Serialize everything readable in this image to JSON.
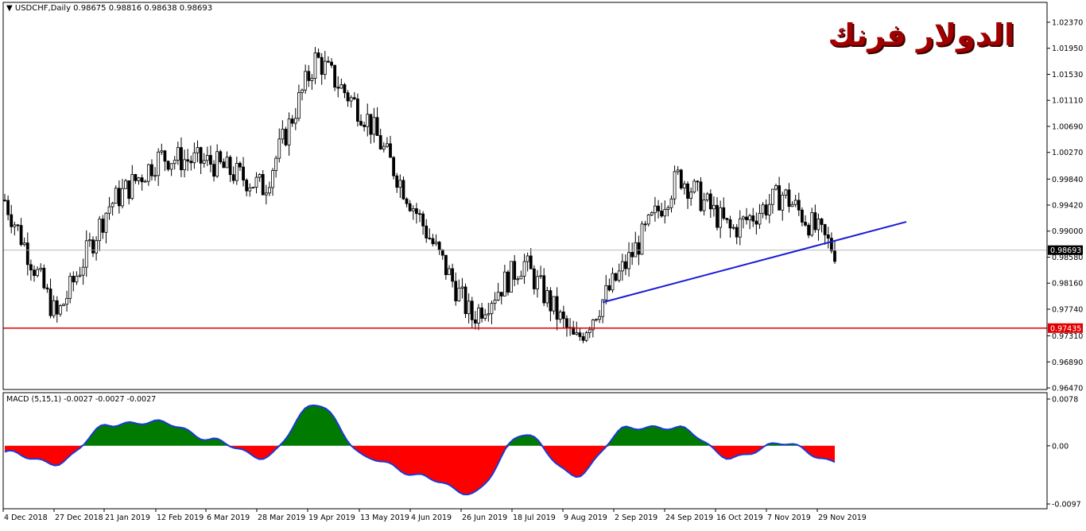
{
  "header": {
    "symbol_line": "USDCHF,Daily  0.98675 0.98816 0.98638 0.98693",
    "overlay_title": "الدولار فرنك"
  },
  "macd": {
    "label": "MACD (5,15,1) -0.0027 -0.0027 -0.0027",
    "axis_ticks": [
      "0.0078",
      "0.00",
      "-0.0097"
    ]
  },
  "price_axis_ticks": [
    "1.02370",
    "1.01950",
    "1.01530",
    "1.01110",
    "1.00690",
    "1.00270",
    "0.99840",
    "0.99420",
    "0.99000",
    "0.98580",
    "0.98160",
    "0.97740",
    "0.97310",
    "0.96890",
    "0.96470"
  ],
  "current_price_label": "0.98693",
  "support_label": "0.97435",
  "date_ticks": [
    "4 Dec 2018",
    "27 Dec 2018",
    "21 Jan 2019",
    "12 Feb 2019",
    "6 Mar 2019",
    "28 Mar 2019",
    "19 Apr 2019",
    "13 May 2019",
    "4 Jun 2019",
    "26 Jun 2019",
    "18 Jul 2019",
    "9 Aug 2019",
    "2 Sep 2019",
    "24 Sep 2019",
    "16 Oct 2019",
    "7 Nov 2019",
    "29 Nov 2019"
  ],
  "colors": {
    "candle": "#000000",
    "support_line": "#e00000",
    "trend_line": "#1a1ad6",
    "macd_positive": "#007a00",
    "macd_negative": "#ff0000",
    "macd_outline": "#1a3ad6",
    "current_price_line": "#b0b0b0"
  },
  "chart_data": [
    {
      "type": "candlestick",
      "title": "USDCHF,Daily",
      "ohlc_last": {
        "open": 0.98675,
        "high": 0.98816,
        "low": 0.98638,
        "close": 0.98693
      },
      "x": [
        "4 Dec 2018",
        "27 Dec 2018",
        "21 Jan 2019",
        "12 Feb 2019",
        "6 Mar 2019",
        "28 Mar 2019",
        "19 Apr 2019",
        "13 May 2019",
        "4 Jun 2019",
        "26 Jun 2019",
        "18 Jul 2019",
        "9 Aug 2019",
        "2 Sep 2019",
        "24 Sep 2019",
        "16 Oct 2019",
        "7 Nov 2019",
        "29 Nov 2019"
      ],
      "close_approx": [
        0.995,
        0.976,
        0.994,
        1.002,
        1.001,
        0.997,
        1.018,
        1.008,
        0.992,
        0.976,
        0.985,
        0.972,
        0.985,
        0.999,
        0.99,
        0.996,
        0.9869
      ],
      "ylim": [
        0.9647,
        1.0237
      ],
      "support_line": 0.97435,
      "current_price": 0.98693,
      "trendline": {
        "from": {
          "date": "26 Aug 2019",
          "price": 0.9785
        },
        "to": {
          "date": "12 Dec 2019",
          "price": 0.9915
        }
      }
    },
    {
      "type": "area",
      "title": "MACD (5,15,1)",
      "x": [
        "4 Dec 2018",
        "27 Dec 2018",
        "21 Jan 2019",
        "12 Feb 2019",
        "6 Mar 2019",
        "28 Mar 2019",
        "19 Apr 2019",
        "13 May 2019",
        "4 Jun 2019",
        "26 Jun 2019",
        "18 Jul 2019",
        "9 Aug 2019",
        "2 Sep 2019",
        "24 Sep 2019",
        "16 Oct 2019",
        "7 Nov 2019",
        "29 Nov 2019"
      ],
      "values": [
        -0.001,
        -0.003,
        0.0035,
        0.004,
        0.001,
        -0.002,
        0.007,
        -0.002,
        -0.005,
        -0.008,
        0.002,
        -0.005,
        0.003,
        0.003,
        -0.002,
        0.0005,
        -0.0027
      ],
      "ylim": [
        -0.0097,
        0.0078
      ]
    }
  ]
}
